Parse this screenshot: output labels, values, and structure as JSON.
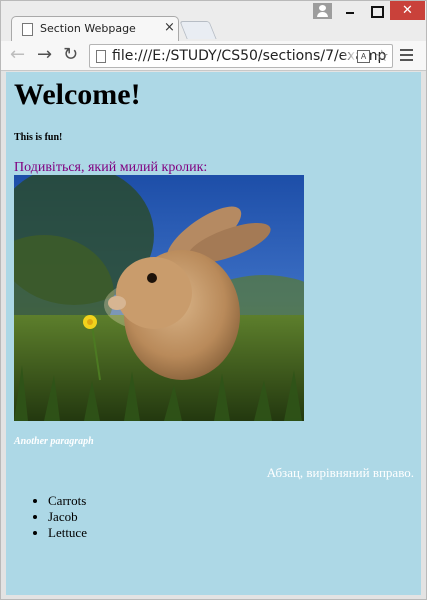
{
  "browser": {
    "tab_title": "Section Webpage",
    "tab_close": "×",
    "url": "file:///E:/STUDY/CS50/sections/7/examp",
    "icons": {
      "back": "back-arrow-icon",
      "forward": "forward-arrow-icon",
      "reload": "reload-icon",
      "page": "page-icon",
      "translate": "translate-icon",
      "star": "star-icon",
      "menu": "hamburger-menu-icon",
      "profile": "profile-icon"
    },
    "colors": {
      "close_button": "#c9413a",
      "toolbar": "#f7f7f7"
    }
  },
  "page": {
    "background": "#add8e6",
    "heading": "Welcome!",
    "subheading": "This is fun!",
    "caption": "Подивіться, який милий кролик:",
    "caption_color": "#800080",
    "image": "bunny-in-grass-with-dandelion",
    "another_paragraph": "Another paragraph",
    "right_paragraph": "Абзац, вирівняний вправо.",
    "list": [
      "Carrots",
      "Jacob",
      "Lettuce"
    ]
  }
}
